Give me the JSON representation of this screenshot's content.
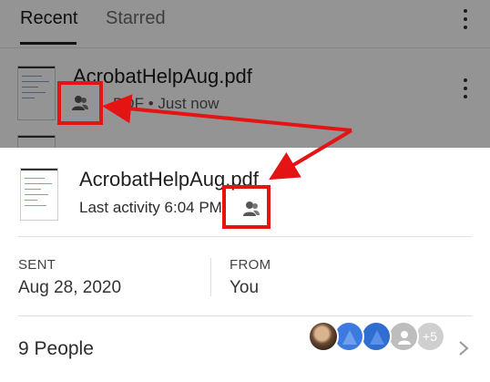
{
  "background_app": {
    "tabs": [
      {
        "label": "Recent",
        "active": true
      },
      {
        "label": "Starred",
        "active": false
      }
    ],
    "recent_item": {
      "filename": "AcrobatHelpAug.pdf",
      "meta": "PDF • Just now",
      "shared_icon": "shared-person-icon"
    },
    "overflow_icon": "more-vertical-icon"
  },
  "sheet": {
    "filename": "AcrobatHelpAug.pdf",
    "last_activity": "Last activity 6:04 PM",
    "shared_icon": "shared-person-icon",
    "sent_label": "SENT",
    "sent_value": "Aug 28, 2020",
    "from_label": "FROM",
    "from_value": "You",
    "people_label": "9 People",
    "more_people_badge": "+5",
    "chevron_icon": "chevron-right-icon"
  },
  "annotation": {
    "color": "#e41414"
  }
}
